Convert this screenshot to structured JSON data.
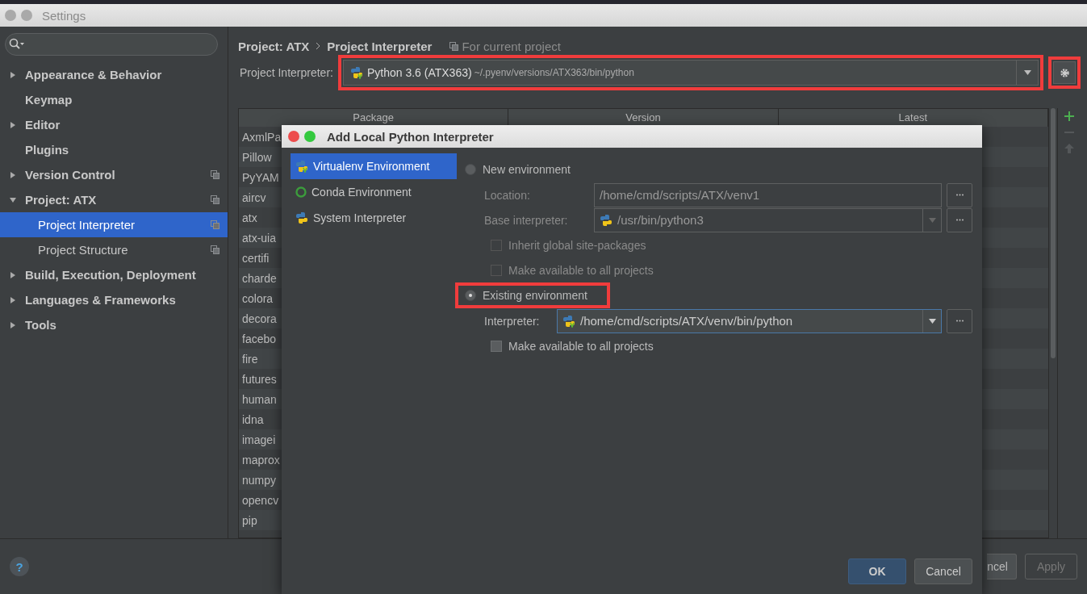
{
  "window": {
    "title": "Settings"
  },
  "sidebar": {
    "items": [
      {
        "label": "Appearance & Behavior",
        "expandable": true,
        "expanded": false,
        "project_scoped": false,
        "selected": false
      },
      {
        "label": "Keymap",
        "expandable": false,
        "project_scoped": false,
        "selected": false
      },
      {
        "label": "Editor",
        "expandable": true,
        "expanded": false,
        "project_scoped": false,
        "selected": false
      },
      {
        "label": "Plugins",
        "expandable": false,
        "project_scoped": false,
        "selected": false
      },
      {
        "label": "Version Control",
        "expandable": true,
        "expanded": false,
        "project_scoped": true,
        "selected": false
      },
      {
        "label": "Project: ATX",
        "expandable": true,
        "expanded": true,
        "project_scoped": true,
        "selected": false,
        "children": [
          {
            "label": "Project Interpreter",
            "project_scoped": true,
            "selected": true
          },
          {
            "label": "Project Structure",
            "project_scoped": true,
            "selected": false
          }
        ]
      },
      {
        "label": "Build, Execution, Deployment",
        "expandable": true,
        "expanded": false,
        "project_scoped": false,
        "selected": false
      },
      {
        "label": "Languages & Frameworks",
        "expandable": true,
        "expanded": false,
        "project_scoped": false,
        "selected": false
      },
      {
        "label": "Tools",
        "expandable": true,
        "expanded": false,
        "project_scoped": false,
        "selected": false
      }
    ]
  },
  "breadcrumb": [
    "Project: ATX",
    "Project Interpreter"
  ],
  "scope": "For current project",
  "interpreter": {
    "label": "Project Interpreter:",
    "name": "Python 3.6 (ATX363)",
    "path": "~/.pyenv/versions/ATX363/bin/python",
    "highlighted": true
  },
  "settings_button": {
    "highlighted": true
  },
  "table": {
    "columns": [
      "Package",
      "Version",
      "Latest"
    ],
    "rows": [
      "AxmlPa",
      "Pillow",
      "PyYAM",
      "aircv",
      "atx",
      "atx-uia",
      "certifi",
      "charde",
      "colora",
      "decora",
      "facebo",
      "fire",
      "futures",
      "human",
      "idna",
      "imagei",
      "maprox",
      "numpy",
      "opencv",
      "pip"
    ]
  },
  "help": "?",
  "buttons": [
    {
      "label": "ncel",
      "disabled": false,
      "cut": true
    },
    {
      "label": "Apply",
      "disabled": true,
      "cut": false
    }
  ],
  "dialog": {
    "title": "Add Local Python Interpreter",
    "types": [
      {
        "label": "Virtualenv Environment",
        "kind": "venv",
        "selected": true
      },
      {
        "label": "Conda Environment",
        "kind": "conda",
        "selected": false
      },
      {
        "label": "System Interpreter",
        "kind": "python",
        "selected": false
      }
    ],
    "new_environment": {
      "label": "New environment",
      "selected": false,
      "highlighted": false,
      "location": {
        "label": "Location:",
        "value": "/home/cmd/scripts/ATX/venv1",
        "disabled": true
      },
      "base_interpreter": {
        "label": "Base interpreter:",
        "value": "/usr/bin/python3",
        "disabled": true
      },
      "checkboxes": [
        {
          "label": "Inherit global site-packages",
          "checked": false,
          "disabled": true
        },
        {
          "label": "Make available to all projects",
          "checked": false,
          "disabled": true
        }
      ]
    },
    "existing_environment": {
      "label": "Existing environment",
      "selected": true,
      "highlighted": true,
      "interpreter": {
        "label": "Interpreter:",
        "value": "/home/cmd/scripts/ATX/venv/bin/python",
        "disabled": false
      },
      "checkboxes": [
        {
          "label": "Make available to all projects",
          "checked": false,
          "disabled": false
        }
      ]
    },
    "buttons": [
      {
        "label": "OK",
        "default": true
      },
      {
        "label": "Cancel",
        "default": false
      }
    ]
  }
}
